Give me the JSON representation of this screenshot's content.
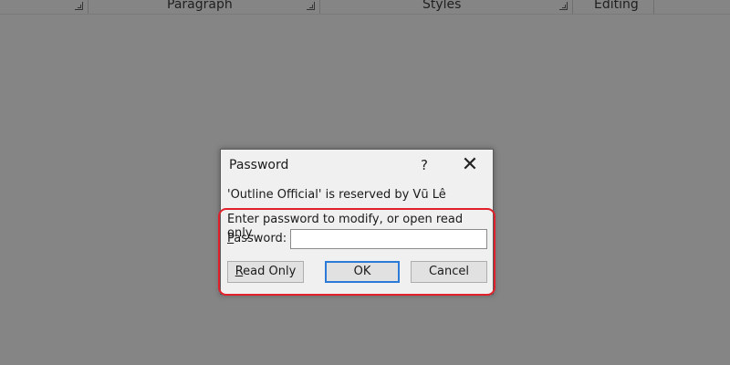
{
  "ribbon": {
    "groups": [
      "Paragraph",
      "Styles",
      "Editing"
    ]
  },
  "dialog": {
    "title": "Password",
    "help_label": "?",
    "close_label": "✕",
    "reserved_text": "'Outline Official' is reserved by Vũ Lê",
    "instruction": "Enter password to modify, or open read only.",
    "password_label_underlined": "P",
    "password_label_rest": "assword:",
    "password_value": "",
    "buttons": {
      "read_only_underlined": "R",
      "read_only_rest": "ead Only",
      "ok": "OK",
      "cancel": "Cancel"
    }
  },
  "colors": {
    "highlight": "#e0212b",
    "ok_focus": "#2b7ad6",
    "overlay": "#858585"
  }
}
